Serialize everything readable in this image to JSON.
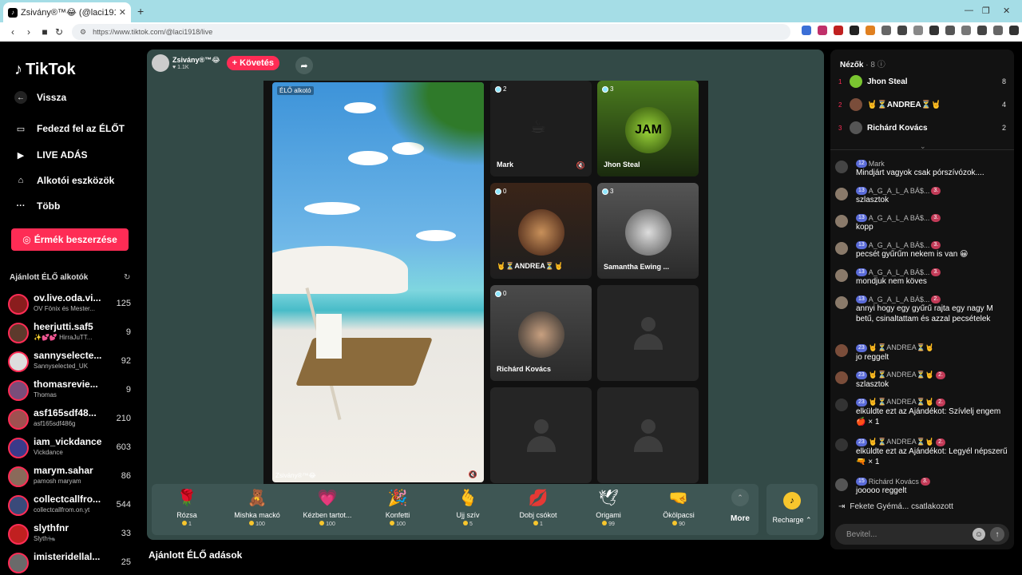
{
  "browser": {
    "tab_title": "Zsivány®™😂 (@laci1918) É…",
    "url": "https://www.tiktok.com/@laci1918/live",
    "newtab": "+"
  },
  "sidebar": {
    "logo": "TikTok",
    "nav": [
      {
        "label": "Vissza",
        "icon": "back-arrow-icon"
      },
      {
        "label": "Fedezd fel az ÉLŐT",
        "icon": "tv-icon"
      },
      {
        "label": "LIVE ADÁS",
        "icon": "camera-icon"
      },
      {
        "label": "Alkotói eszközök",
        "icon": "house-icon"
      },
      {
        "label": "Több",
        "icon": "more-dots-icon"
      }
    ],
    "coins_button": "Érmék beszerzése",
    "recommended_title": "Ajánlott ÉLŐ alkotók",
    "creators": [
      {
        "name": "ov.live.oda.vi...",
        "sub": "OV Fönix és Mester...",
        "count": "125",
        "color": "#8a1d1d"
      },
      {
        "name": "heerjutti.saf5",
        "sub": "✨💕💕 HirraJuTT...",
        "count": "9",
        "color": "#5d3a2c"
      },
      {
        "name": "sannyselecte...",
        "sub": "Sannyselected_UK",
        "count": "92",
        "color": "#ddd"
      },
      {
        "name": "thomasrevie...",
        "sub": "Thomas",
        "count": "9",
        "color": "#7a4d7a"
      },
      {
        "name": "asf165sdf48...",
        "sub": "asf165sdf486g",
        "count": "210",
        "color": "#a05050"
      },
      {
        "name": "iam_vickdance",
        "sub": "Vickdance",
        "count": "603",
        "color": "#3a3a8a"
      },
      {
        "name": "marym.sahar",
        "sub": "pamosh maryam",
        "count": "86",
        "color": "#8a6a5a"
      },
      {
        "name": "collectcallfro...",
        "sub": "collectcallfrom.on.yt",
        "count": "544",
        "color": "#3a4a7a"
      },
      {
        "name": "slythfnr",
        "sub": "Slyth🐜",
        "count": "33",
        "color": "#c02020"
      },
      {
        "name": "imisteridellal...",
        "sub": "",
        "count": "25",
        "color": "#6a6a6a"
      }
    ]
  },
  "live": {
    "host_name": "Zsivány®™😂",
    "host_likes": "♥ 1.1K",
    "follow_button": "+ Követés",
    "host_label": "ÉLŐ alkotó",
    "host_footer": "Zsivány®™😂",
    "guests": [
      {
        "count": "2",
        "name": "Mark"
      },
      {
        "count": "3",
        "name": "Jhon Steal"
      },
      {
        "count": "0",
        "name": "🤘⏳ANDREA⏳🤘"
      },
      {
        "count": "3",
        "name": "Samantha Ewing ..."
      },
      {
        "count": "0",
        "name": "Richárd Kovács"
      }
    ],
    "gifts": [
      {
        "name": "Rózsa",
        "price": "1",
        "icon": "🌹"
      },
      {
        "name": "Mishka mackó",
        "price": "100",
        "icon": "🧸"
      },
      {
        "name": "Kézben tartot...",
        "price": "100",
        "icon": "💗"
      },
      {
        "name": "Konfetti",
        "price": "100",
        "icon": "🎉"
      },
      {
        "name": "Ujj szív",
        "price": "5",
        "icon": "🫰"
      },
      {
        "name": "Dobj csókot",
        "price": "1",
        "icon": "💋"
      },
      {
        "name": "Origami",
        "price": "99",
        "icon": "🕊"
      },
      {
        "name": "Ökölpacsi",
        "price": "90",
        "icon": "🤜"
      }
    ],
    "more_label": "More",
    "recharge_label": "Recharge ⌃"
  },
  "recommended_title": "Ajánlott ÉLŐ adások",
  "viewers": {
    "title": "Nézők",
    "count": "· 8",
    "list": [
      {
        "rank": "1",
        "name": "Jhon Steal",
        "count": "8",
        "color": "#7ac530"
      },
      {
        "rank": "2",
        "name": "🤘⏳ANDREA⏳🤘",
        "count": "4",
        "color": "#7a4d3a"
      },
      {
        "rank": "3",
        "name": "Richárd Kovács",
        "count": "2",
        "color": "#555"
      }
    ]
  },
  "chat": [
    {
      "meta": [
        "12",
        "Mark"
      ],
      "text": "Mindjárt vagyok csak pórszívózok....",
      "av": "#444"
    },
    {
      "meta": [
        "13",
        "A_G_A_L_A BÁ$...",
        "3."
      ],
      "text": "szlasztok",
      "av": "#8a7a6a"
    },
    {
      "meta": [
        "13",
        "A_G_A_L_A BÁ$...",
        "3."
      ],
      "text": "kopp",
      "av": "#8a7a6a"
    },
    {
      "meta": [
        "13",
        "A_G_A_L_A BÁ$...",
        "3."
      ],
      "text": "pecsét gyűrűm nekem is van 😀",
      "av": "#8a7a6a"
    },
    {
      "meta": [
        "13",
        "A_G_A_L_A BÁ$...",
        "3."
      ],
      "text": "mondjuk nem köves",
      "av": "#8a7a6a"
    },
    {
      "meta": [
        "13",
        "A_G_A_L_A BÁ$...",
        "2."
      ],
      "text": "annyi hogy egy gyűrű rajta egy nagy M betű, csinaltattam és azzal pecsételek",
      "av": "#8a7a6a"
    },
    {
      "meta": [
        "23",
        "🤘⏳ANDREA⏳🤘"
      ],
      "text": "jo reggelt",
      "av": "#7a4d3a"
    },
    {
      "meta": [
        "23",
        "🤘⏳ANDREA⏳🤘",
        "2."
      ],
      "text": "szlasztok",
      "av": "#7a4d3a"
    },
    {
      "meta": [
        "23",
        "🤘⏳ANDREA⏳🤘",
        "2."
      ],
      "text": "elküldte ezt az Ajándékot: Szívlelj engem 🍎 × 1",
      "av": "#333"
    },
    {
      "meta": [
        "23",
        "🤘⏳ANDREA⏳🤘",
        "2."
      ],
      "text": "elküldte ezt az Ajándékot: Legyél népszerű 🔫 × 1",
      "av": "#333"
    },
    {
      "meta": [
        "15",
        "Richárd Kovács",
        "3."
      ],
      "text": "jooooo reggelt",
      "av": "#555"
    }
  ],
  "join_text": "Fekete Gyémá... csatlakozott",
  "input_placeholder": "Bevitel..."
}
